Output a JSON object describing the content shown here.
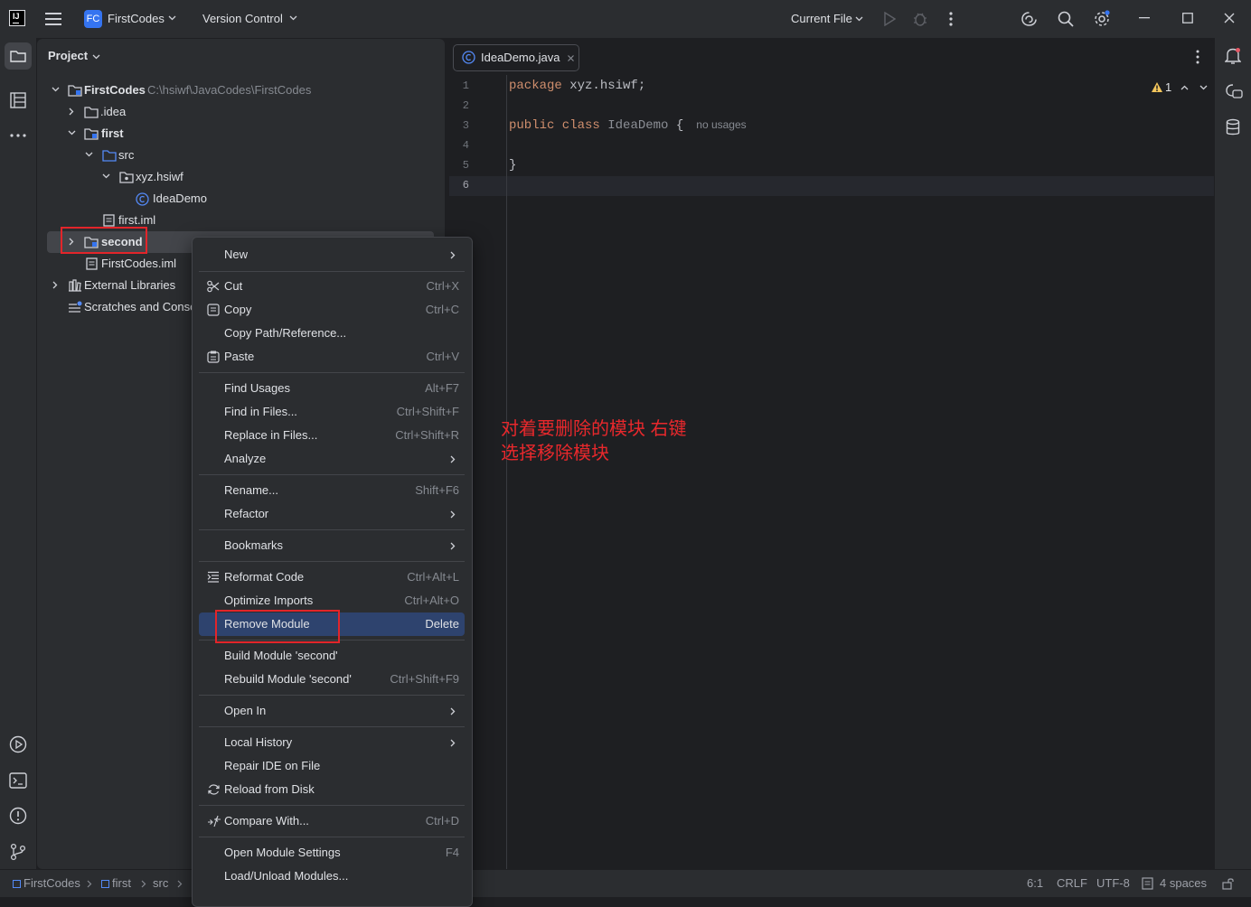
{
  "titlebar": {
    "project_badge": "FC",
    "project_name": "FirstCodes",
    "vcs": "Version Control",
    "run_config": "Current File"
  },
  "project_panel": {
    "title": "Project",
    "tree": {
      "root": {
        "label": "FirstCodes",
        "path": "C:\\hsiwf\\JavaCodes\\FirstCodes"
      },
      "idea": ".idea",
      "first": "first",
      "src": "src",
      "package": "xyz.hsiwf",
      "class": "IdeaDemo",
      "first_iml": "first.iml",
      "second": "second",
      "firstcodes_iml": "FirstCodes.iml",
      "external_libraries": "External Libraries",
      "scratches": "Scratches and Conso"
    }
  },
  "editor": {
    "tab_label": "IdeaDemo.java",
    "line_numbers": [
      "1",
      "2",
      "3",
      "4",
      "5",
      "6"
    ],
    "code": {
      "l1_kw": "package",
      "l1_rest": " xyz.hsiwf;",
      "l3_kw": "public class",
      "l3_cls": "IdeaDemo",
      "l3_brace": "{",
      "l3_hint": "no usages",
      "l5": "}"
    },
    "warnings_count": "1"
  },
  "context_menu": {
    "new": "New",
    "cut": "Cut",
    "cut_sc": "Ctrl+X",
    "copy": "Copy",
    "copy_sc": "Ctrl+C",
    "copy_path": "Copy Path/Reference...",
    "paste": "Paste",
    "paste_sc": "Ctrl+V",
    "find_usages": "Find Usages",
    "find_usages_sc": "Alt+F7",
    "find_in_files": "Find in Files...",
    "find_in_files_sc": "Ctrl+Shift+F",
    "replace_in_files": "Replace in Files...",
    "replace_in_files_sc": "Ctrl+Shift+R",
    "analyze": "Analyze",
    "rename": "Rename...",
    "rename_sc": "Shift+F6",
    "refactor": "Refactor",
    "bookmarks": "Bookmarks",
    "reformat": "Reformat Code",
    "reformat_sc": "Ctrl+Alt+L",
    "optimize": "Optimize Imports",
    "optimize_sc": "Ctrl+Alt+O",
    "remove_module": "Remove Module",
    "remove_module_sc": "Delete",
    "build_module": "Build Module 'second'",
    "rebuild_module": "Rebuild Module 'second'",
    "rebuild_module_sc": "Ctrl+Shift+F9",
    "open_in": "Open In",
    "local_history": "Local History",
    "repair_ide": "Repair IDE on File",
    "reload": "Reload from Disk",
    "compare": "Compare With...",
    "compare_sc": "Ctrl+D",
    "module_settings": "Open Module Settings",
    "module_settings_sc": "F4",
    "load_unload": "Load/Unload Modules..."
  },
  "annotation": {
    "line1": "对着要删除的模块 右键",
    "line2": "选择移除模块"
  },
  "statusbar": {
    "crumb_project": "FirstCodes",
    "crumb_module": "first",
    "crumb_src": "src",
    "position": "6:1",
    "line_sep": "CRLF",
    "encoding": "UTF-8",
    "indent": "4 spaces"
  },
  "colors": {
    "accent": "#3574f0",
    "selection": "#2e436e",
    "annotation_red": "#e2252a",
    "keyword": "#cf8e6d"
  }
}
